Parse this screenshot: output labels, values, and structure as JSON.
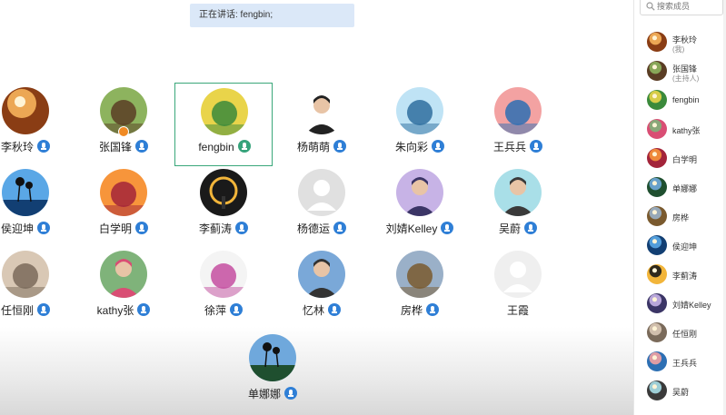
{
  "status_bar": {
    "speaking_text": "正在讲话: fengbin;"
  },
  "participants": [
    {
      "name": "李秋玲",
      "mic": "blue",
      "colors": [
        "#f6b25b",
        "#8a3d14"
      ],
      "art": "sunset"
    },
    {
      "name": "张国锋",
      "mic": "blue",
      "colors": [
        "#8db35e",
        "#5a3d24"
      ],
      "art": "collage",
      "host_badge": true
    },
    {
      "name": "fengbin",
      "mic": "green",
      "colors": [
        "#e9d44a",
        "#3b8a3b"
      ],
      "art": "cartoon",
      "active": true
    },
    {
      "name": "杨萌萌",
      "mic": "blue",
      "colors": [
        "#ffffff",
        "#222222"
      ],
      "art": "portrait"
    },
    {
      "name": "朱向彩",
      "mic": "blue",
      "colors": [
        "#bfe3f5",
        "#2f6f9f"
      ],
      "art": "sky"
    },
    {
      "name": "王兵兵",
      "mic": "blue",
      "colors": [
        "#f3a2a2",
        "#2d6fb3"
      ],
      "art": "panda"
    },
    {
      "name": "侯迎坤",
      "mic": "blue",
      "colors": [
        "#5aa7e6",
        "#123f73"
      ],
      "art": "palms"
    },
    {
      "name": "白学明",
      "mic": "blue",
      "colors": [
        "#f7953b",
        "#a3243a"
      ],
      "art": "city"
    },
    {
      "name": "李蓟涛",
      "mic": "blue",
      "colors": [
        "#1a1a1a",
        "#f2b53a"
      ],
      "art": "ring"
    },
    {
      "name": "杨德运",
      "mic": "blue",
      "colors": [
        "#e0e0e0",
        "#ffffff"
      ],
      "art": "default"
    },
    {
      "name": "刘婧Kelley",
      "mic": "blue",
      "colors": [
        "#c7b3e6",
        "#3b3566"
      ],
      "art": "girl"
    },
    {
      "name": "吴蔚",
      "mic": "blue",
      "colors": [
        "#a9dfe8",
        "#3a3a3a"
      ],
      "art": "anime"
    },
    {
      "name": "任恒刚",
      "mic": "blue",
      "colors": [
        "#d9c8b5",
        "#7a6a5a"
      ],
      "art": "cat"
    },
    {
      "name": "kathy张",
      "mic": "blue",
      "colors": [
        "#7fb37a",
        "#d94e74"
      ],
      "art": "woman"
    },
    {
      "name": "徐萍",
      "mic": "blue",
      "colors": [
        "#f4f4f4",
        "#c44ea0"
      ],
      "art": "drawing"
    },
    {
      "name": "忆林",
      "mic": "blue",
      "colors": [
        "#7aa8d8",
        "#333333"
      ],
      "art": "man"
    },
    {
      "name": "房桦",
      "mic": "blue",
      "colors": [
        "#9ab0c8",
        "#7a5a2e"
      ],
      "art": "robot"
    },
    {
      "name": "王霞",
      "mic": "none",
      "colors": [
        "#efefef",
        "#ffffff"
      ],
      "art": "default"
    },
    {
      "name": "单娜娜",
      "mic": "blue",
      "colors": [
        "#6fa8dc",
        "#1f4f2f"
      ],
      "art": "palms"
    }
  ],
  "sidebar": {
    "search_placeholder": "搜索成员",
    "members": [
      {
        "name": "李秋玲",
        "role": "(我)",
        "colors": [
          "#f6b25b",
          "#8a3d14"
        ]
      },
      {
        "name": "张国锋",
        "role": "(主持人)",
        "colors": [
          "#8db35e",
          "#5a3d24"
        ]
      },
      {
        "name": "fengbin",
        "role": "",
        "colors": [
          "#e9d44a",
          "#3b8a3b"
        ]
      },
      {
        "name": "kathy张",
        "role": "",
        "colors": [
          "#7fb37a",
          "#d94e74"
        ]
      },
      {
        "name": "白学明",
        "role": "",
        "colors": [
          "#f7953b",
          "#a3243a"
        ]
      },
      {
        "name": "单娜娜",
        "role": "",
        "colors": [
          "#6fa8dc",
          "#1f4f2f"
        ]
      },
      {
        "name": "房桦",
        "role": "",
        "colors": [
          "#9ab0c8",
          "#7a5a2e"
        ]
      },
      {
        "name": "侯迎坤",
        "role": "",
        "colors": [
          "#5aa7e6",
          "#123f73"
        ]
      },
      {
        "name": "李蓟涛",
        "role": "",
        "colors": [
          "#1a1a1a",
          "#f2b53a"
        ]
      },
      {
        "name": "刘婧Kelley",
        "role": "",
        "colors": [
          "#c7b3e6",
          "#3b3566"
        ]
      },
      {
        "name": "任恒刚",
        "role": "",
        "colors": [
          "#d9c8b5",
          "#7a6a5a"
        ]
      },
      {
        "name": "王兵兵",
        "role": "",
        "colors": [
          "#f3a2a2",
          "#2d6fb3"
        ]
      },
      {
        "name": "吴蔚",
        "role": "",
        "colors": [
          "#a9dfe8",
          "#3a3a3a"
        ]
      }
    ]
  }
}
